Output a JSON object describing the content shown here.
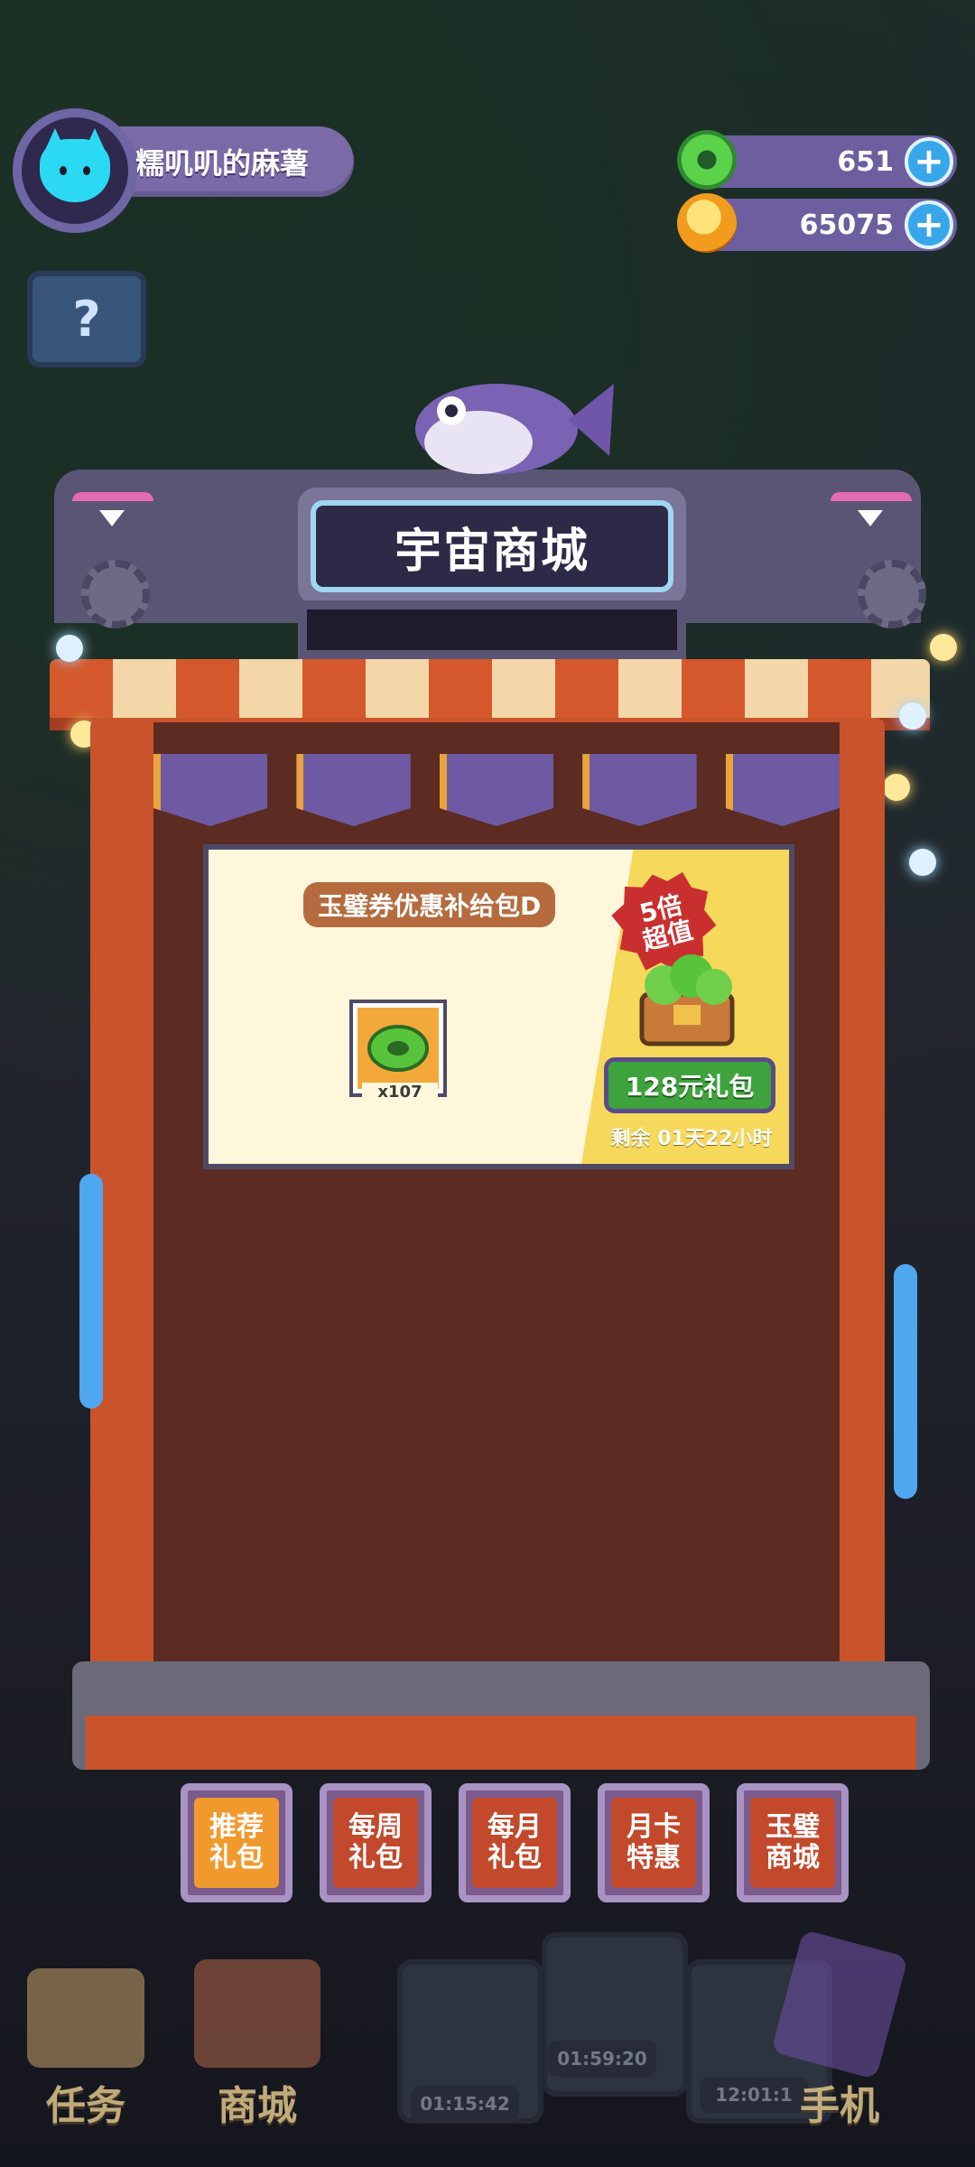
{
  "user": {
    "name": "糯叽叽的麻薯"
  },
  "currencies": [
    {
      "name": "jade-ticket",
      "value": "651"
    },
    {
      "name": "gold-coin",
      "value": "65075"
    }
  ],
  "shop": {
    "title": "宇宙商城"
  },
  "offer": {
    "title": "玉璧券优惠补给包D",
    "item_count": "x107",
    "badge": "5倍\n超值",
    "price": "128元礼包",
    "remaining": "剩余 01天22小时"
  },
  "tabs": [
    {
      "label": "推荐\n礼包",
      "active": true
    },
    {
      "label": "每周\n礼包",
      "active": false
    },
    {
      "label": "每月\n礼包",
      "active": false
    },
    {
      "label": "月卡\n特惠",
      "active": false
    },
    {
      "label": "玉璧\n商城",
      "active": false
    }
  ],
  "bottom_nav": {
    "tasks": "任务",
    "shop": "商城",
    "phone": "手机",
    "timers": [
      "01:15:42",
      "01:59:20",
      "12:01:1"
    ]
  },
  "colors": {
    "accent_orange": "#f09a2e",
    "price_green": "#3ea33c",
    "plus_blue": "#3aa6ea"
  }
}
